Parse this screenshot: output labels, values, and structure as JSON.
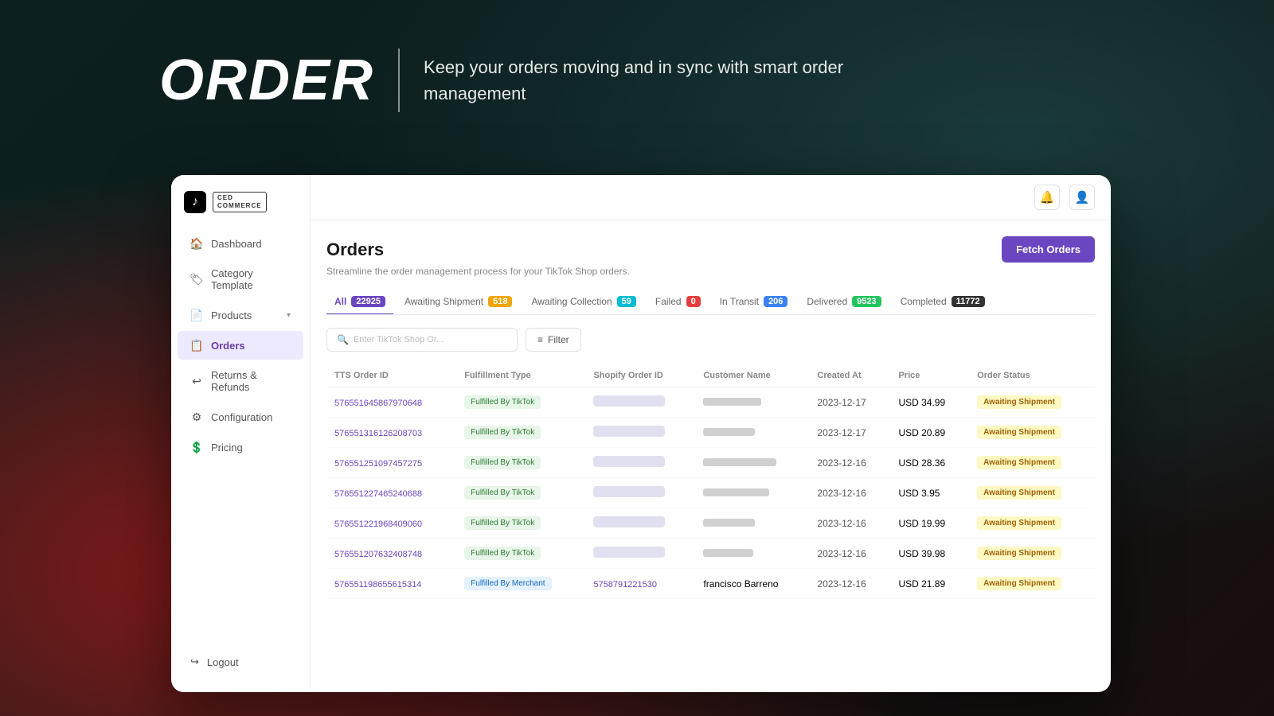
{
  "hero": {
    "order_text": "ORDER",
    "subtitle": "Keep your orders moving and in sync with smart order management"
  },
  "sidebar": {
    "logo_text_line1": "CED",
    "logo_text_line2": "COMMERCE",
    "items": [
      {
        "id": "dashboard",
        "label": "Dashboard",
        "icon": "🏠",
        "active": false
      },
      {
        "id": "category-template",
        "label": "Category Template",
        "icon": "🏷",
        "active": false
      },
      {
        "id": "products",
        "label": "Products",
        "icon": "📄",
        "active": false,
        "has_chevron": true
      },
      {
        "id": "orders",
        "label": "Orders",
        "icon": "📋",
        "active": true
      },
      {
        "id": "returns-refunds",
        "label": "Returns & Refunds",
        "icon": "↩",
        "active": false
      },
      {
        "id": "configuration",
        "label": "Configuration",
        "icon": "⚙",
        "active": false
      },
      {
        "id": "pricing",
        "label": "Pricing",
        "icon": "💲",
        "active": false
      }
    ],
    "logout_label": "Logout"
  },
  "top_bar": {
    "notification_icon": "🔔",
    "user_icon": "👤"
  },
  "orders_page": {
    "title": "Orders",
    "subtitle": "Streamline the order management process for your TikTok Shop orders.",
    "fetch_button_label": "Fetch Orders",
    "tabs": [
      {
        "id": "all",
        "label": "All",
        "count": "22925",
        "badge_class": "badge-purple",
        "active": true
      },
      {
        "id": "awaiting-shipment",
        "label": "Awaiting Shipment",
        "count": "518",
        "badge_class": "badge-yellow",
        "active": false
      },
      {
        "id": "awaiting-collection",
        "label": "Awaiting Collection",
        "count": "59",
        "badge_class": "badge-teal",
        "active": false
      },
      {
        "id": "failed",
        "label": "Failed",
        "count": "0",
        "badge_class": "badge-red",
        "active": false
      },
      {
        "id": "in-transit",
        "label": "In Transit",
        "count": "206",
        "badge_class": "badge-blue",
        "active": false
      },
      {
        "id": "delivered",
        "label": "Delivered",
        "count": "9523",
        "badge_class": "badge-green",
        "active": false
      },
      {
        "id": "completed",
        "label": "Completed",
        "count": "11772",
        "badge_class": "badge-dark",
        "active": false
      }
    ],
    "search_placeholder": "Enter TikTok Shop Or...",
    "filter_label": "Filter",
    "table": {
      "columns": [
        "TTS Order ID",
        "Fulfillment Type",
        "Shopify Order ID",
        "Customer Name",
        "Created At",
        "Price",
        "Order Status"
      ],
      "rows": [
        {
          "id": "576551645867970648",
          "fulfillment": "Fulfilled By TikTok",
          "fulfillment_type": "tiktok",
          "shopify_id": null,
          "customer": null,
          "created_at": "2023-12-17",
          "price": "USD 34.99",
          "status": "Awaiting Shipment",
          "status_type": "awaiting"
        },
        {
          "id": "576551316126208703",
          "fulfillment": "Fulfilled By TikTok",
          "fulfillment_type": "tiktok",
          "shopify_id": null,
          "customer": null,
          "created_at": "2023-12-17",
          "price": "USD 20.89",
          "status": "Awaiting Shipment",
          "status_type": "awaiting"
        },
        {
          "id": "576551251097457275",
          "fulfillment": "Fulfilled By TikTok",
          "fulfillment_type": "tiktok",
          "shopify_id": null,
          "customer": null,
          "created_at": "2023-12-16",
          "price": "USD 28.36",
          "status": "Awaiting Shipment",
          "status_type": "awaiting"
        },
        {
          "id": "576551227465240688",
          "fulfillment": "Fulfilled By TikTok",
          "fulfillment_type": "tiktok",
          "shopify_id": null,
          "customer": null,
          "created_at": "2023-12-16",
          "price": "USD 3.95",
          "status": "Awaiting Shipment",
          "status_type": "awaiting"
        },
        {
          "id": "576551221968409060",
          "fulfillment": "Fulfilled By TikTok",
          "fulfillment_type": "tiktok",
          "shopify_id": null,
          "customer": null,
          "created_at": "2023-12-16",
          "price": "USD 19.99",
          "status": "Awaiting Shipment",
          "status_type": "awaiting"
        },
        {
          "id": "576551207632408748",
          "fulfillment": "Fulfilled By TikTok",
          "fulfillment_type": "tiktok",
          "shopify_id": null,
          "customer": null,
          "created_at": "2023-12-16",
          "price": "USD 39.98",
          "status": "Awaiting Shipment",
          "status_type": "awaiting"
        },
        {
          "id": "576551198655615314",
          "fulfillment": "Fulfilled By\nMerchant",
          "fulfillment_type": "merchant",
          "shopify_id": "5758791221530",
          "customer": "francisco Barreno",
          "created_at": "2023-12-16",
          "price": "USD 21.89",
          "status": "Awaiting Shipment",
          "status_type": "awaiting"
        }
      ]
    }
  }
}
